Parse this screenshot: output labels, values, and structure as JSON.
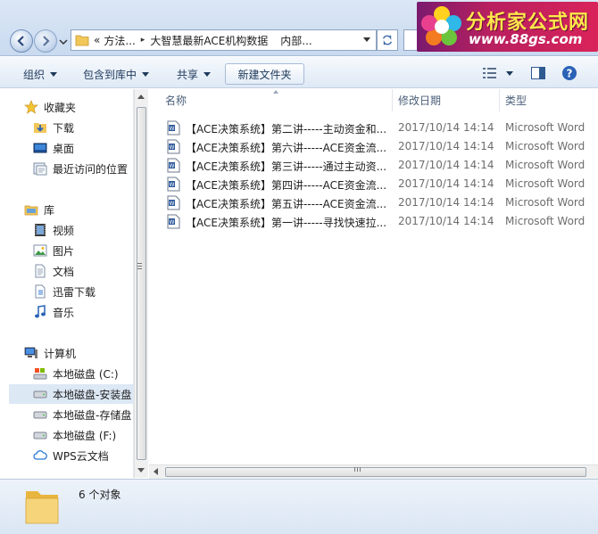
{
  "address": {
    "segments": [
      "«",
      "方法...",
      "大智慧最新ACE机构数据",
      "内部..."
    ]
  },
  "logo": {
    "title": "分析家公式网",
    "url": "www.88gs.com"
  },
  "toolbar": {
    "organize": "组织",
    "include_in_library": "包含到库中",
    "share": "共享",
    "new_folder": "新建文件夹"
  },
  "sidebar": {
    "favorites": {
      "label": "收藏夹",
      "items": [
        "下载",
        "桌面",
        "最近访问的位置"
      ]
    },
    "library": {
      "label": "库",
      "items": [
        "视频",
        "图片",
        "文档",
        "迅雷下载",
        "音乐"
      ]
    },
    "computer": {
      "label": "计算机",
      "items": [
        "本地磁盘 (C:)",
        "本地磁盘-安装盘",
        "本地磁盘-存储盘",
        "本地磁盘 (F:)",
        "WPS云文档"
      ],
      "selected_index": 1
    }
  },
  "columns": {
    "name": "名称",
    "date": "修改日期",
    "type": "类型"
  },
  "files": [
    {
      "name": "【ACE决策系统】第二讲-----主动资金和...",
      "date": "2017/10/14 14:14",
      "type": "Microsoft Word"
    },
    {
      "name": "【ACE决策系统】第六讲-----ACE资金流...",
      "date": "2017/10/14 14:14",
      "type": "Microsoft Word"
    },
    {
      "name": "【ACE决策系统】第三讲-----通过主动资...",
      "date": "2017/10/14 14:14",
      "type": "Microsoft Word"
    },
    {
      "name": "【ACE决策系统】第四讲-----ACE资金流...",
      "date": "2017/10/14 14:14",
      "type": "Microsoft Word"
    },
    {
      "name": "【ACE决策系统】第五讲-----ACE资金流...",
      "date": "2017/10/14 14:14",
      "type": "Microsoft Word"
    },
    {
      "name": "【ACE决策系统】第一讲-----寻找快速拉...",
      "date": "2017/10/14 14:14",
      "type": "Microsoft Word"
    }
  ],
  "status": {
    "count_text": "6 个对象"
  },
  "colors": {
    "accent": "#1e395b",
    "selection": "#dde8f5",
    "logo_bg": "#b8205f"
  }
}
